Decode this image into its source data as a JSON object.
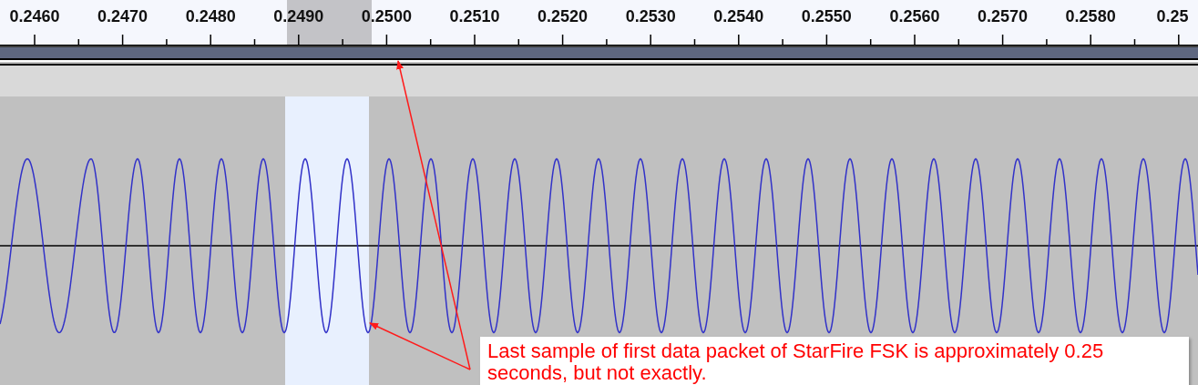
{
  "ruler": {
    "labels": [
      "0.2460",
      "0.2470",
      "0.2480",
      "0.2490",
      "0.2500",
      "0.2510",
      "0.2520",
      "0.2530",
      "0.2540",
      "0.2550",
      "0.2560",
      "0.2570",
      "0.2580",
      "0.25"
    ]
  },
  "callout": {
    "text": "Last sample of first data packet of StarFire FSK is approximately 0.25 seconds, but not exactly."
  }
}
